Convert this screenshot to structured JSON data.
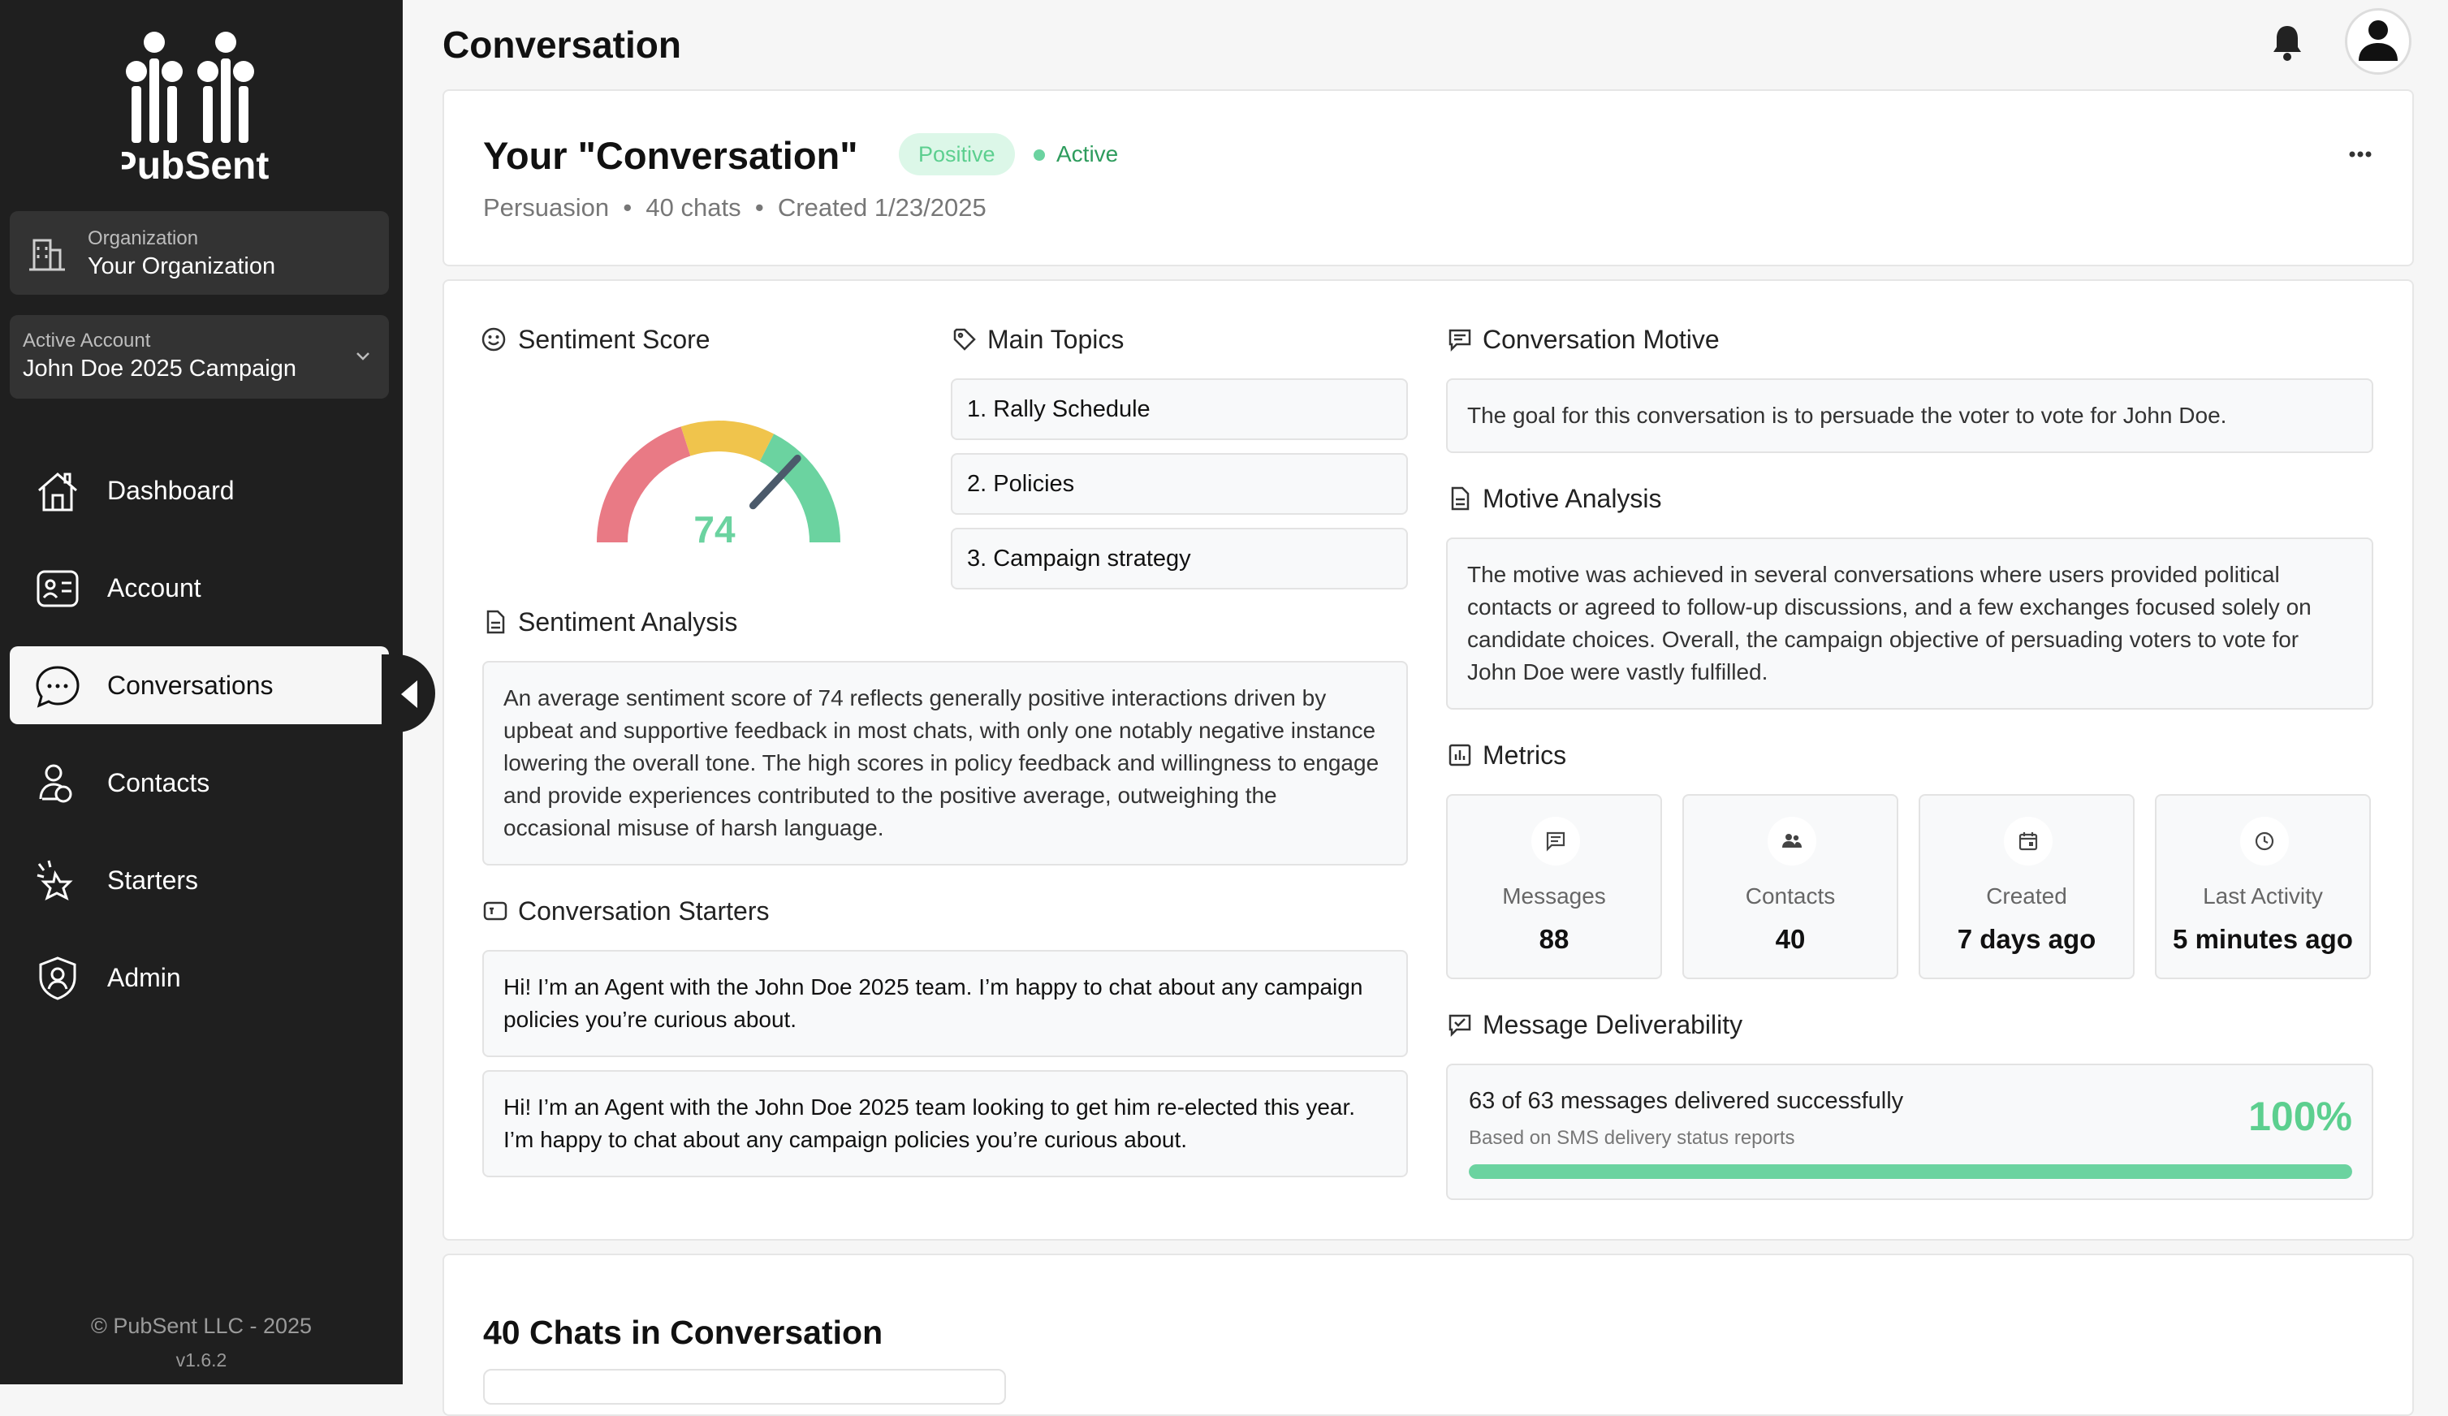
{
  "brand": {
    "name": "PubSent"
  },
  "org": {
    "label": "Organization",
    "name": "Your Organization"
  },
  "account": {
    "label": "Active Account",
    "name": "John Doe 2025 Campaign"
  },
  "nav": [
    {
      "label": "Dashboard",
      "icon": "home-icon"
    },
    {
      "label": "Account",
      "icon": "id-card-icon"
    },
    {
      "label": "Conversations",
      "icon": "chat-bubble-icon"
    },
    {
      "label": "Contacts",
      "icon": "users-icon"
    },
    {
      "label": "Starters",
      "icon": "sparkle-burst-icon"
    },
    {
      "label": "Admin",
      "icon": "shield-user-icon"
    }
  ],
  "footer": {
    "copyright": "© PubSent LLC - 2025",
    "version": "v1.6.2"
  },
  "page": {
    "title": "Conversation"
  },
  "conversation": {
    "title": "Your \"Conversation\"",
    "sentiment_badge": "Positive",
    "status": "Active",
    "type": "Persuasion",
    "chats": "40 chats",
    "created": "Created 1/23/2025"
  },
  "sentiment": {
    "title": "Sentiment Score",
    "score": "74",
    "score_value": 74
  },
  "topics": {
    "title": "Main Topics",
    "items": [
      "1. Rally Schedule",
      "2. Policies",
      "3. Campaign strategy"
    ]
  },
  "sentiment_analysis": {
    "title": "Sentiment Analysis",
    "text": "An average sentiment score of 74 reflects generally positive interactions driven by upbeat and supportive feedback in most chats, with only one notably negative instance lowering the overall tone. The high scores in policy feedback and willingness to engage and provide experiences contributed to the positive average, outweighing the occasional misuse of harsh language."
  },
  "starters": {
    "title": "Conversation Starters",
    "items": [
      "Hi! I’m an Agent with the John Doe 2025 team. I’m happy to chat about any campaign policies you’re curious about.",
      "Hi! I’m an Agent with the John Doe 2025 team looking to get him re-elected this year. I’m happy to chat about any campaign policies you’re curious about."
    ]
  },
  "motive": {
    "title": "Conversation Motive",
    "text": "The goal for this conversation is to persuade the voter to vote for John Doe."
  },
  "motive_analysis": {
    "title": "Motive Analysis",
    "text": "The motive was achieved in several conversations where users provided political contacts or agreed to follow-up discussions, and a few exchanges focused solely on candidate choices. Overall, the campaign objective of persuading voters to vote for John Doe were vastly fulfilled."
  },
  "metrics": {
    "title": "Metrics",
    "items": [
      {
        "label": "Messages",
        "value": "88",
        "icon": "message-icon"
      },
      {
        "label": "Contacts",
        "value": "40",
        "icon": "people-icon"
      },
      {
        "label": "Created",
        "value": "7 days ago",
        "icon": "calendar-icon"
      },
      {
        "label": "Last Activity",
        "value": "5 minutes ago",
        "icon": "clock-icon"
      }
    ]
  },
  "deliverability": {
    "title": "Message Deliverability",
    "summary": "63 of 63 messages delivered successfully",
    "note": "Based on SMS delivery status reports",
    "percent": "100%",
    "fraction": 1.0
  },
  "chats_section": {
    "title": "40 Chats in Conversation"
  },
  "colors": {
    "sidebar_bg": "#1f1f1f",
    "positive_green": "#5ccf8f",
    "gauge_red": "#e97a85",
    "gauge_yellow": "#f0c44c",
    "gauge_green": "#6bd3a0",
    "needle": "#4b5a6b"
  }
}
